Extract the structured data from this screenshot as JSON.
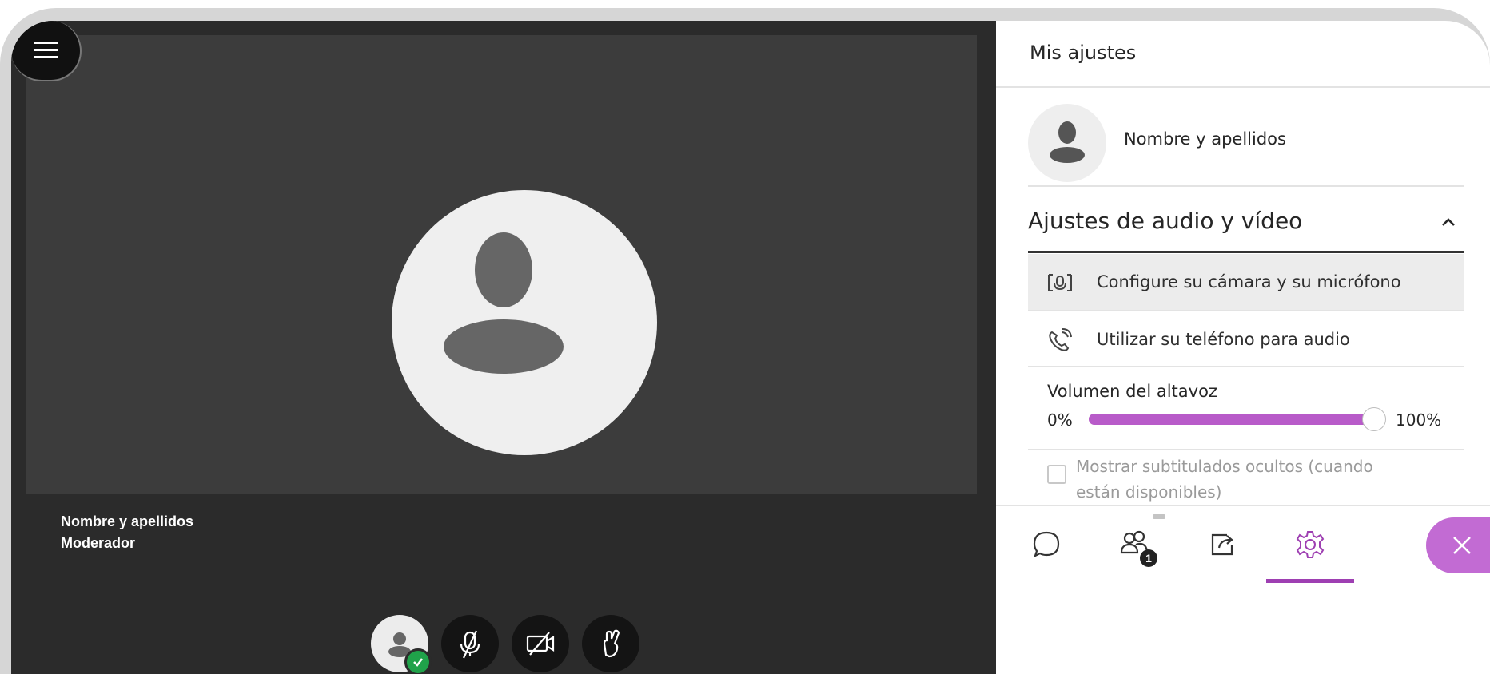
{
  "panel": {
    "title": "Mis ajustes",
    "profile_name": "Nombre y apellidos",
    "section_title": "Ajustes de audio y vídeo",
    "options": [
      {
        "label": "Configure su cámara y su micrófono",
        "icon": "camera-mic-icon",
        "selected": true
      },
      {
        "label": "Utilizar su teléfono para audio",
        "icon": "phone-audio-icon",
        "selected": false
      }
    ],
    "volume": {
      "label": "Volumen del altavoz",
      "min_label": "0%",
      "max_label": "100%",
      "value": 1.0
    },
    "captions": {
      "label": "Mostrar subtitulados ocultos (cuando están disponibles)",
      "checked": false
    }
  },
  "stage": {
    "participant_name": "Nombre y apellidos",
    "participant_role": "Moderador",
    "controls": [
      "avatar-status-icon",
      "mic-off-icon",
      "camera-off-icon",
      "raise-hand-icon"
    ]
  },
  "bottom_tabs": [
    {
      "name": "chat",
      "icon": "chat-icon"
    },
    {
      "name": "attendees",
      "icon": "attendees-icon",
      "badge": "1"
    },
    {
      "name": "share",
      "icon": "share-content-icon"
    },
    {
      "name": "settings",
      "icon": "gear-icon",
      "active": true
    },
    {
      "name": "close",
      "icon": "close-icon"
    }
  ],
  "colors": {
    "accent": "#b85bc9",
    "active_tab": "#9e3fb2",
    "close_button": "#c26bd3",
    "stage_bg": "#2b2b2b",
    "status_ok": "#20a24a"
  }
}
